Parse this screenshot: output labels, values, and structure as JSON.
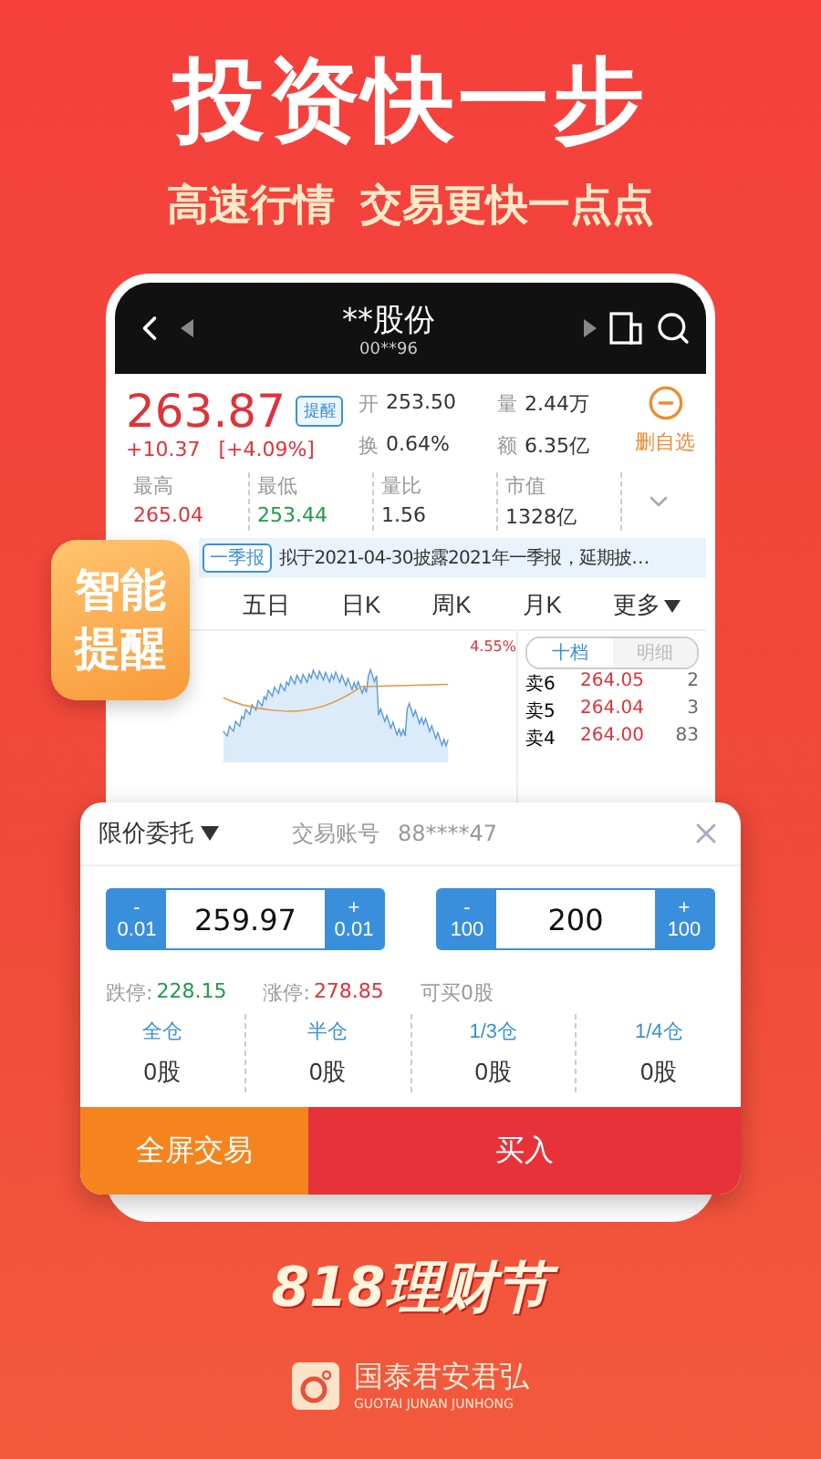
{
  "headline": "投资快一步",
  "subheadlines": [
    "高速行情",
    "交易更快一点点"
  ],
  "stock_header": {
    "name": "**股份",
    "code": "00**96"
  },
  "quote": {
    "price": "263.87",
    "alert_button": "提醒",
    "change": "+10.37",
    "change_pct": "[+4.09%]",
    "remove_watchlist": "删自选"
  },
  "stats": [
    {
      "label": "开",
      "value": "253.50"
    },
    {
      "label": "量",
      "value": "2.44万"
    },
    {
      "label": "换",
      "value": "0.64%"
    },
    {
      "label": "额",
      "value": "6.35亿"
    }
  ],
  "metrics": [
    {
      "label": "最高",
      "value": "265.04",
      "color": "#e0323a"
    },
    {
      "label": "最低",
      "value": "253.44",
      "color": "#1f9a4a"
    },
    {
      "label": "量比",
      "value": "1.56",
      "color": "#333333"
    },
    {
      "label": "市值",
      "value": "1328亿",
      "color": "#333333"
    }
  ],
  "notice": {
    "tag": "一季报",
    "text": "拟于2021-04-30披露2021年一季报，延期披…"
  },
  "chart_tabs": [
    "五日",
    "日K",
    "周K",
    "月K",
    "更多"
  ],
  "chart": {
    "change_label": "4.55%"
  },
  "order_book": {
    "tabs": [
      {
        "label": "十档",
        "selected": true
      },
      {
        "label": "明细",
        "selected": false
      }
    ],
    "rows": [
      {
        "side": "卖6",
        "price": "264.05",
        "volume": "2"
      },
      {
        "side": "卖5",
        "price": "264.04",
        "volume": "3"
      },
      {
        "side": "卖4",
        "price": "264.00",
        "volume": "83"
      }
    ]
  },
  "badge": "智能提醒",
  "trade_panel": {
    "order_type": "限价委托",
    "account_label": "交易账号",
    "account": "88****47",
    "steppers": [
      {
        "value": "259.97",
        "minus_sign": "-",
        "minus_step": "0.01",
        "plus_sign": "+",
        "plus_step": "0.01"
      },
      {
        "value": "200",
        "minus_sign": "-",
        "minus_step": "100",
        "plus_sign": "+",
        "plus_step": "100"
      }
    ],
    "limits": [
      {
        "label": "跌停:",
        "value": "228.15",
        "color": "#1f9a4a"
      },
      {
        "label": "涨停:",
        "value": "278.85",
        "color": "#e0323a"
      }
    ],
    "buyable": "可买0股",
    "positions": [
      {
        "label": "全仓",
        "shares": "0股"
      },
      {
        "label": "半仓",
        "shares": "0股"
      },
      {
        "label": "1/3仓",
        "shares": "0股"
      },
      {
        "label": "1/4仓",
        "shares": "0股"
      }
    ],
    "fullscreen_button": "全屏交易",
    "buy_button": "买入"
  },
  "footer": {
    "festival": "818理财节",
    "brand": "国泰君安君弘",
    "brand_en": "GUOTAI JUNAN JUNHONG"
  }
}
